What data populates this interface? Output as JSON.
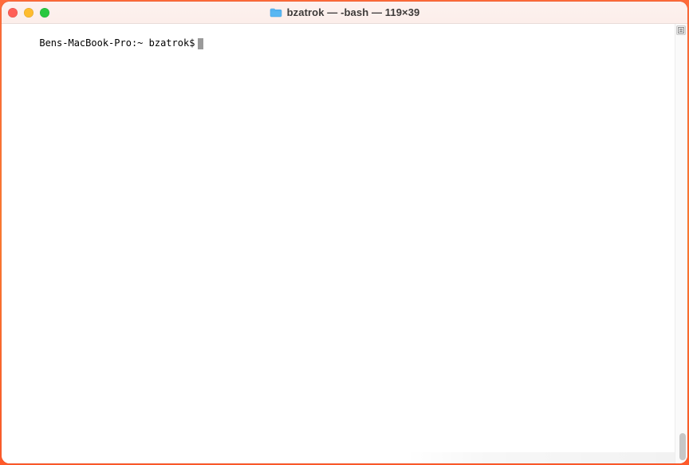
{
  "window": {
    "title": "bzatrok — -bash — 119×39",
    "traffic_light_colors": {
      "close": "#ff5f57",
      "minimize": "#febc2e",
      "zoom": "#28c840"
    },
    "folder_icon_name": "home-folder-icon"
  },
  "terminal": {
    "prompt": "Bens-MacBook-Pro:~ bzatrok$",
    "cursor_visible": true
  },
  "scroll": {
    "thumb_visible": true,
    "lock_badge": "scroll-lock-icon"
  }
}
